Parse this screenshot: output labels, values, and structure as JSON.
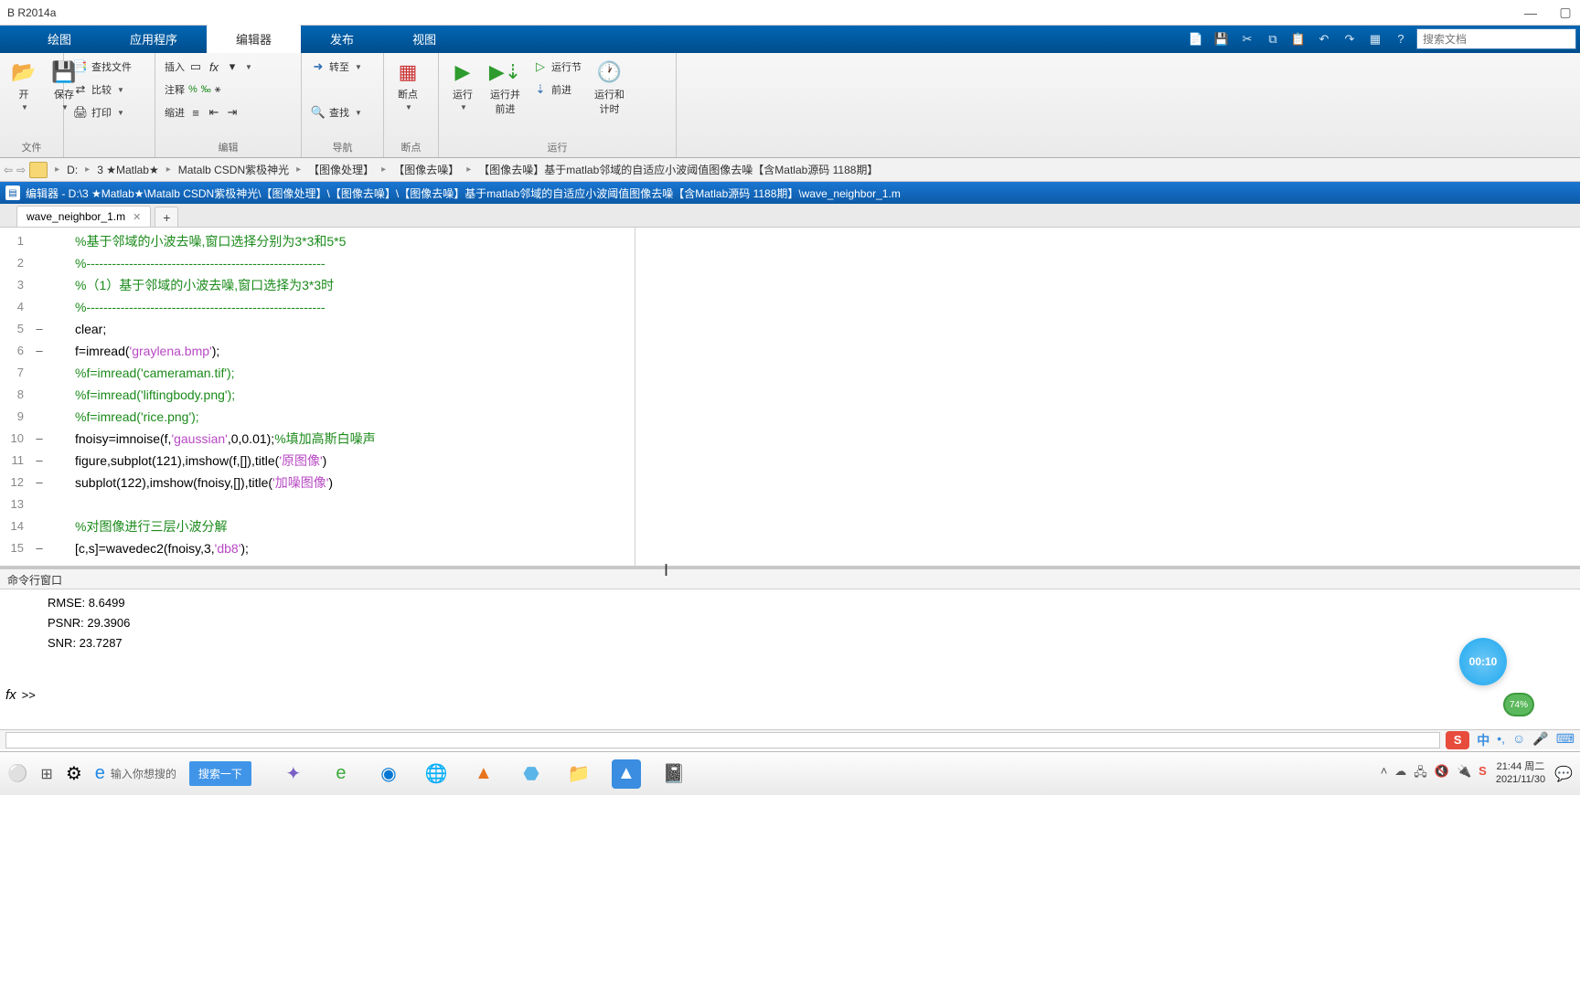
{
  "window": {
    "title": "B R2014a"
  },
  "ribbon": {
    "tabs": [
      "绘图",
      "应用程序",
      "编辑器",
      "发布",
      "视图"
    ],
    "active": 2,
    "search_placeholder": "搜索文档"
  },
  "toolstrip": {
    "groups": {
      "file": {
        "label": "文件",
        "open": "开",
        "save": "保存",
        "find_files": "查找文件",
        "compare": "比较",
        "print": "打印"
      },
      "edit": {
        "label": "编辑",
        "insert": "插入",
        "comment": "注释",
        "indent": "缩进",
        "goto": "转至",
        "find": "查找"
      },
      "nav": {
        "label": "导航"
      },
      "bp": {
        "label": "断点",
        "breakpoints": "断点"
      },
      "run": {
        "label": "运行",
        "run": "运行",
        "run_advance": "运行并\n前进",
        "run_section": "运行节",
        "advance": "前进",
        "run_time": "运行和\n计时"
      }
    }
  },
  "address": {
    "segments": [
      "D:",
      "3 ★Matlab★",
      "Matalb CSDN紫极神光",
      "【图像处理】",
      "【图像去噪】",
      "【图像去噪】基于matlab邻域的自适应小波阈值图像去噪【含Matlab源码 1188期】"
    ]
  },
  "editor": {
    "title": "编辑器 - D:\\3 ★Matlab★\\Matalb CSDN紫极神光\\【图像处理】\\【图像去噪】\\【图像去噪】基于matlab邻域的自适应小波阈值图像去噪【含Matlab源码 1188期】\\wave_neighbor_1.m",
    "tab": "wave_neighbor_1.m",
    "lines": [
      {
        "n": "1",
        "d": "",
        "parts": [
          {
            "t": "%基于邻域的小波去噪,窗口选择分别为3*3和5*5",
            "c": "cm"
          }
        ]
      },
      {
        "n": "2",
        "d": "",
        "parts": [
          {
            "t": "%--------------------------------------------------------",
            "c": "cm"
          }
        ]
      },
      {
        "n": "3",
        "d": "",
        "parts": [
          {
            "t": "%（1）基于邻域的小波去噪,窗口选择为3*3时",
            "c": "cm"
          }
        ]
      },
      {
        "n": "4",
        "d": "",
        "parts": [
          {
            "t": "%--------------------------------------------------------",
            "c": "cm"
          }
        ]
      },
      {
        "n": "5",
        "d": "–",
        "parts": [
          {
            "t": "clear;",
            "c": "kw"
          }
        ]
      },
      {
        "n": "6",
        "d": "–",
        "parts": [
          {
            "t": "f=imread(",
            "c": "kw"
          },
          {
            "t": "'graylena.bmp'",
            "c": "str"
          },
          {
            "t": ");",
            "c": "kw"
          }
        ]
      },
      {
        "n": "7",
        "d": "",
        "parts": [
          {
            "t": "%f=imread('cameraman.tif');",
            "c": "cm"
          }
        ]
      },
      {
        "n": "8",
        "d": "",
        "parts": [
          {
            "t": "%f=imread('liftingbody.png');",
            "c": "cm"
          }
        ]
      },
      {
        "n": "9",
        "d": "",
        "parts": [
          {
            "t": "%f=imread('rice.png');",
            "c": "cm"
          }
        ]
      },
      {
        "n": "10",
        "d": "–",
        "parts": [
          {
            "t": "fnoisy=imnoise(f,",
            "c": "kw"
          },
          {
            "t": "'gaussian'",
            "c": "str"
          },
          {
            "t": ",0,0.01);",
            "c": "kw"
          },
          {
            "t": "%填加高斯白噪声",
            "c": "cm"
          }
        ]
      },
      {
        "n": "11",
        "d": "–",
        "parts": [
          {
            "t": "figure,subplot(121),imshow(f,[]),title(",
            "c": "kw"
          },
          {
            "t": "'原图像'",
            "c": "str"
          },
          {
            "t": ")",
            "c": "kw"
          }
        ]
      },
      {
        "n": "12",
        "d": "–",
        "parts": [
          {
            "t": "subplot(122),imshow(fnoisy,[]),title(",
            "c": "kw"
          },
          {
            "t": "'加噪图像'",
            "c": "str"
          },
          {
            "t": ")",
            "c": "kw"
          }
        ]
      },
      {
        "n": "13",
        "d": "",
        "parts": [
          {
            "t": "",
            "c": "kw"
          }
        ]
      },
      {
        "n": "14",
        "d": "",
        "parts": [
          {
            "t": "%对图像进行三层小波分解",
            "c": "cm"
          }
        ]
      },
      {
        "n": "15",
        "d": "–",
        "parts": [
          {
            "t": "[c,s]=wavedec2(fnoisy,3,",
            "c": "kw"
          },
          {
            "t": "'db8'",
            "c": "str"
          },
          {
            "t": ");",
            "c": "kw"
          }
        ]
      }
    ]
  },
  "cmd": {
    "title": "命令行窗口",
    "output": [
      "RMSE: 8.6499",
      "PSNR: 29.3906",
      " SNR: 23.7287"
    ]
  },
  "badges": {
    "timer": "00:10",
    "pct": "74%"
  },
  "status": {
    "ime": "中"
  },
  "taskbar": {
    "search_label": "输入你想搜的",
    "search_btn": "搜索一下",
    "time": "21:44 周二",
    "date": "2021/11/30"
  }
}
